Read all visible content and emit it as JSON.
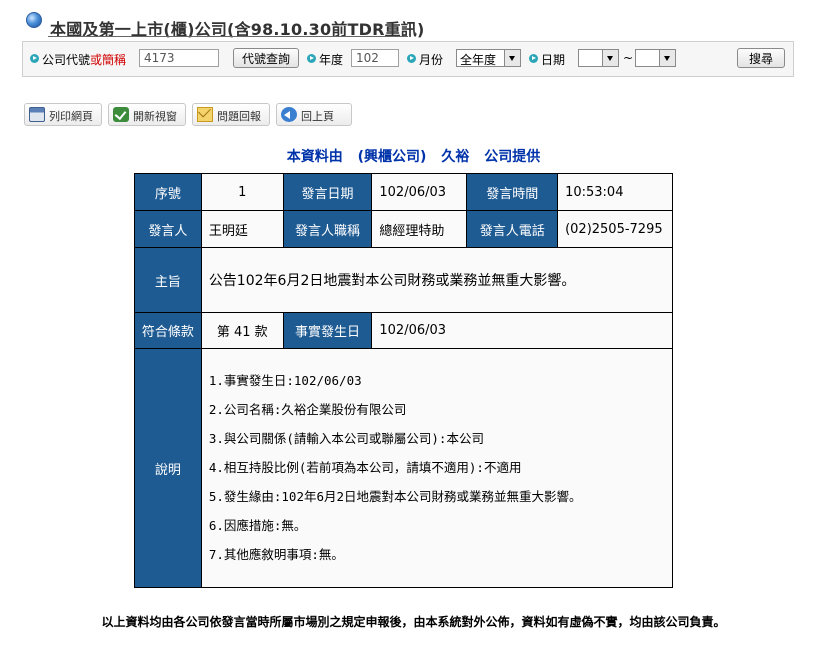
{
  "header": {
    "title": "本國及第一上市(櫃)公司(含98.10.30前TDR重訊)"
  },
  "search": {
    "company_label_a": "公司代號",
    "company_label_or": "或",
    "company_label_b": "簡稱",
    "company_value": "4173",
    "lookup_button": "代號查詢",
    "year_label": "年度",
    "year_value": "102",
    "month_label": "月份",
    "month_value": "全年度",
    "date_label": "日期",
    "date_from": "",
    "date_sep": "~",
    "date_to": "",
    "search_button": "搜尋"
  },
  "actions": [
    {
      "label": "列印網頁",
      "icon": "printer-icon"
    },
    {
      "label": "開新視窗",
      "icon": "checkmark-icon"
    },
    {
      "label": "問題回報",
      "icon": "envelope-icon"
    },
    {
      "label": "回上頁",
      "icon": "back-arrow-icon"
    }
  ],
  "provider": {
    "prefix": "本資料由",
    "type": "(興櫃公司)",
    "company": "久裕",
    "suffix": "公司提供"
  },
  "record": {
    "seq_label": "序號",
    "seq": "1",
    "date_label": "發言日期",
    "date": "102/06/03",
    "time_label": "發言時間",
    "time": "10:53:04",
    "speaker_label": "發言人",
    "speaker": "王明廷",
    "title_label": "發言人職稱",
    "title": "總經理特助",
    "phone_label": "發言人電話",
    "phone": "(02)2505-7295",
    "subject_label": "主旨",
    "subject": "公告102年6月2日地震對本公司財務或業務並無重大影響。",
    "clause_label": "符合條款",
    "clause": "第 41 款",
    "event_date_label": "事實發生日",
    "event_date": "102/06/03",
    "desc_label": "說明",
    "desc_lines": [
      "1.事實發生日:102/06/03",
      "2.公司名稱:久裕企業股份有限公司",
      "3.與公司關係(請輸入本公司或聯屬公司):本公司",
      "4.相互持股比例(若前項為本公司，請填不適用):不適用",
      "5.發生緣由:102年6月2日地震對本公司財務或業務並無重大影響。",
      "6.因應措施:無。",
      "7.其他應敘明事項:無。"
    ]
  },
  "footer": {
    "text": "以上資料均由各公司依發言當時所屬市場別之規定申報後，由本系統對外公佈，資料如有虛偽不實，均由該公司負責。"
  }
}
